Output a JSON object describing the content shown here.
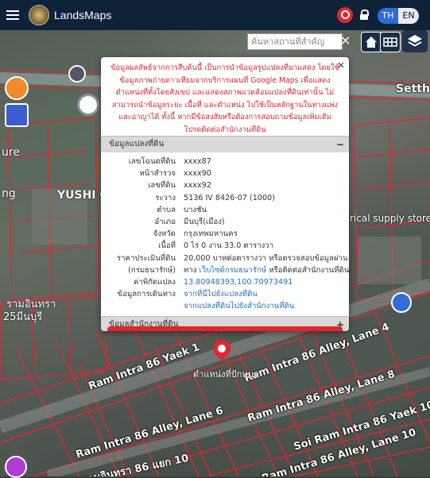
{
  "app": {
    "brand": "LandsMaps"
  },
  "header": {
    "lang_th": "TH",
    "lang_en": "EN"
  },
  "map": {
    "search_placeholder": "ค้นหาสถานที่สำคัญ",
    "search_clear": "×",
    "marker_label": "ตำแหน่งที่ปักหมุด",
    "road_labels": [
      "Ram Intra 86 Yaek 1",
      "Ram Intra 86 Alley, Lane 4",
      "Ram Intra 86 Alley, Lane 6",
      "Ram Intra 86 Alley, Lane 8",
      "Soi Ram Intra 86 Yaek 10",
      "Ram Intra 86 Alley, Lane 10",
      "รามอินทรา 86 แยก 10",
      "Setth"
    ],
    "place_labels": [
      "YUSHI C",
      "ure",
      "ng",
      "rical supply store",
      "รามอินทรา",
      "25มีนบุรี"
    ]
  },
  "popup": {
    "close": "×",
    "disclaimer": "ข้อมูลผลลัพธ์จากการสืบค้นนี้ เป็นการนำข้อมูลรูปแปลงที่มาแสดง โดยใช้ข้อมูลภาพถ่ายดาวเทียมจากบริการแผนที่ Google Maps เพื่อแสดงตำแหน่งที่ตั้งโดยสังเขป และแสดงสภาพแวดล้อมแปลงที่ดินเท่านั้น ไม่สามารถนำข้อมูลระยะ เนื้อที่ และตำแหน่ง ไปใช้เป็นหลักฐานในทางแพ่งและอาญาได้ ทั้งนี้ หากมีข้อสงสัยหรือต้องการสอบถามข้อมูลเพิ่มเติม โปรดติดต่อสำนักงานที่ดิน",
    "section1_title": "ข้อมูลแปลงที่ดิน",
    "section1_toggle": "−",
    "rows": [
      {
        "k": "เลขโฉนดที่ดิน",
        "v": "xxxx87"
      },
      {
        "k": "หน้าสำรวจ",
        "v": "xxxx90"
      },
      {
        "k": "เลขที่ดิน",
        "v": "xxxx92"
      },
      {
        "k": "ระวาง",
        "v": "5136 IV 8426-07 (1000)"
      },
      {
        "k": "ตำบล",
        "v": "บางชัน"
      },
      {
        "k": "อำเภอ",
        "v": "มีนบุรี(เมือง)"
      },
      {
        "k": "จังหวัด",
        "v": "กรุงเทพมหานคร"
      },
      {
        "k": "เนื้อที่",
        "v": "0 ไร่ 0 งาน 33.0 ตารางวา"
      },
      {
        "k": "ราคาประเมินที่ดิน",
        "v": "20,000 บาทต่อตารางวา หรือตรวจสอบข้อมูลผ่าน"
      }
    ],
    "row_treasury_k": "(กรมธนารักษ์)",
    "row_treasury_pre": "ทาง ",
    "row_treasury_link": "เว็บไซต์กรมธนารักษ์",
    "row_treasury_post": " หรือติดต่อสำนักงานที่ดิน",
    "row_coord_k": "ค่าพิกัดแปลง",
    "row_coord_v": "13.80948393,100.70973491",
    "row_route_k": "ข้อมูลการเดินทาง",
    "row_route_v1": "จากที่นี่ไปยังแปลงที่ดิน",
    "row_route_v2": "จากแปลงที่ดินไปยังสำนักงานที่ดิน",
    "section2_title": "ข้อมูลสำนักงานที่ดิน",
    "section2_toggle": "+"
  },
  "colors": {
    "header": "#0e2238",
    "accent": "#e0262e",
    "link": "#2a6cc7"
  }
}
